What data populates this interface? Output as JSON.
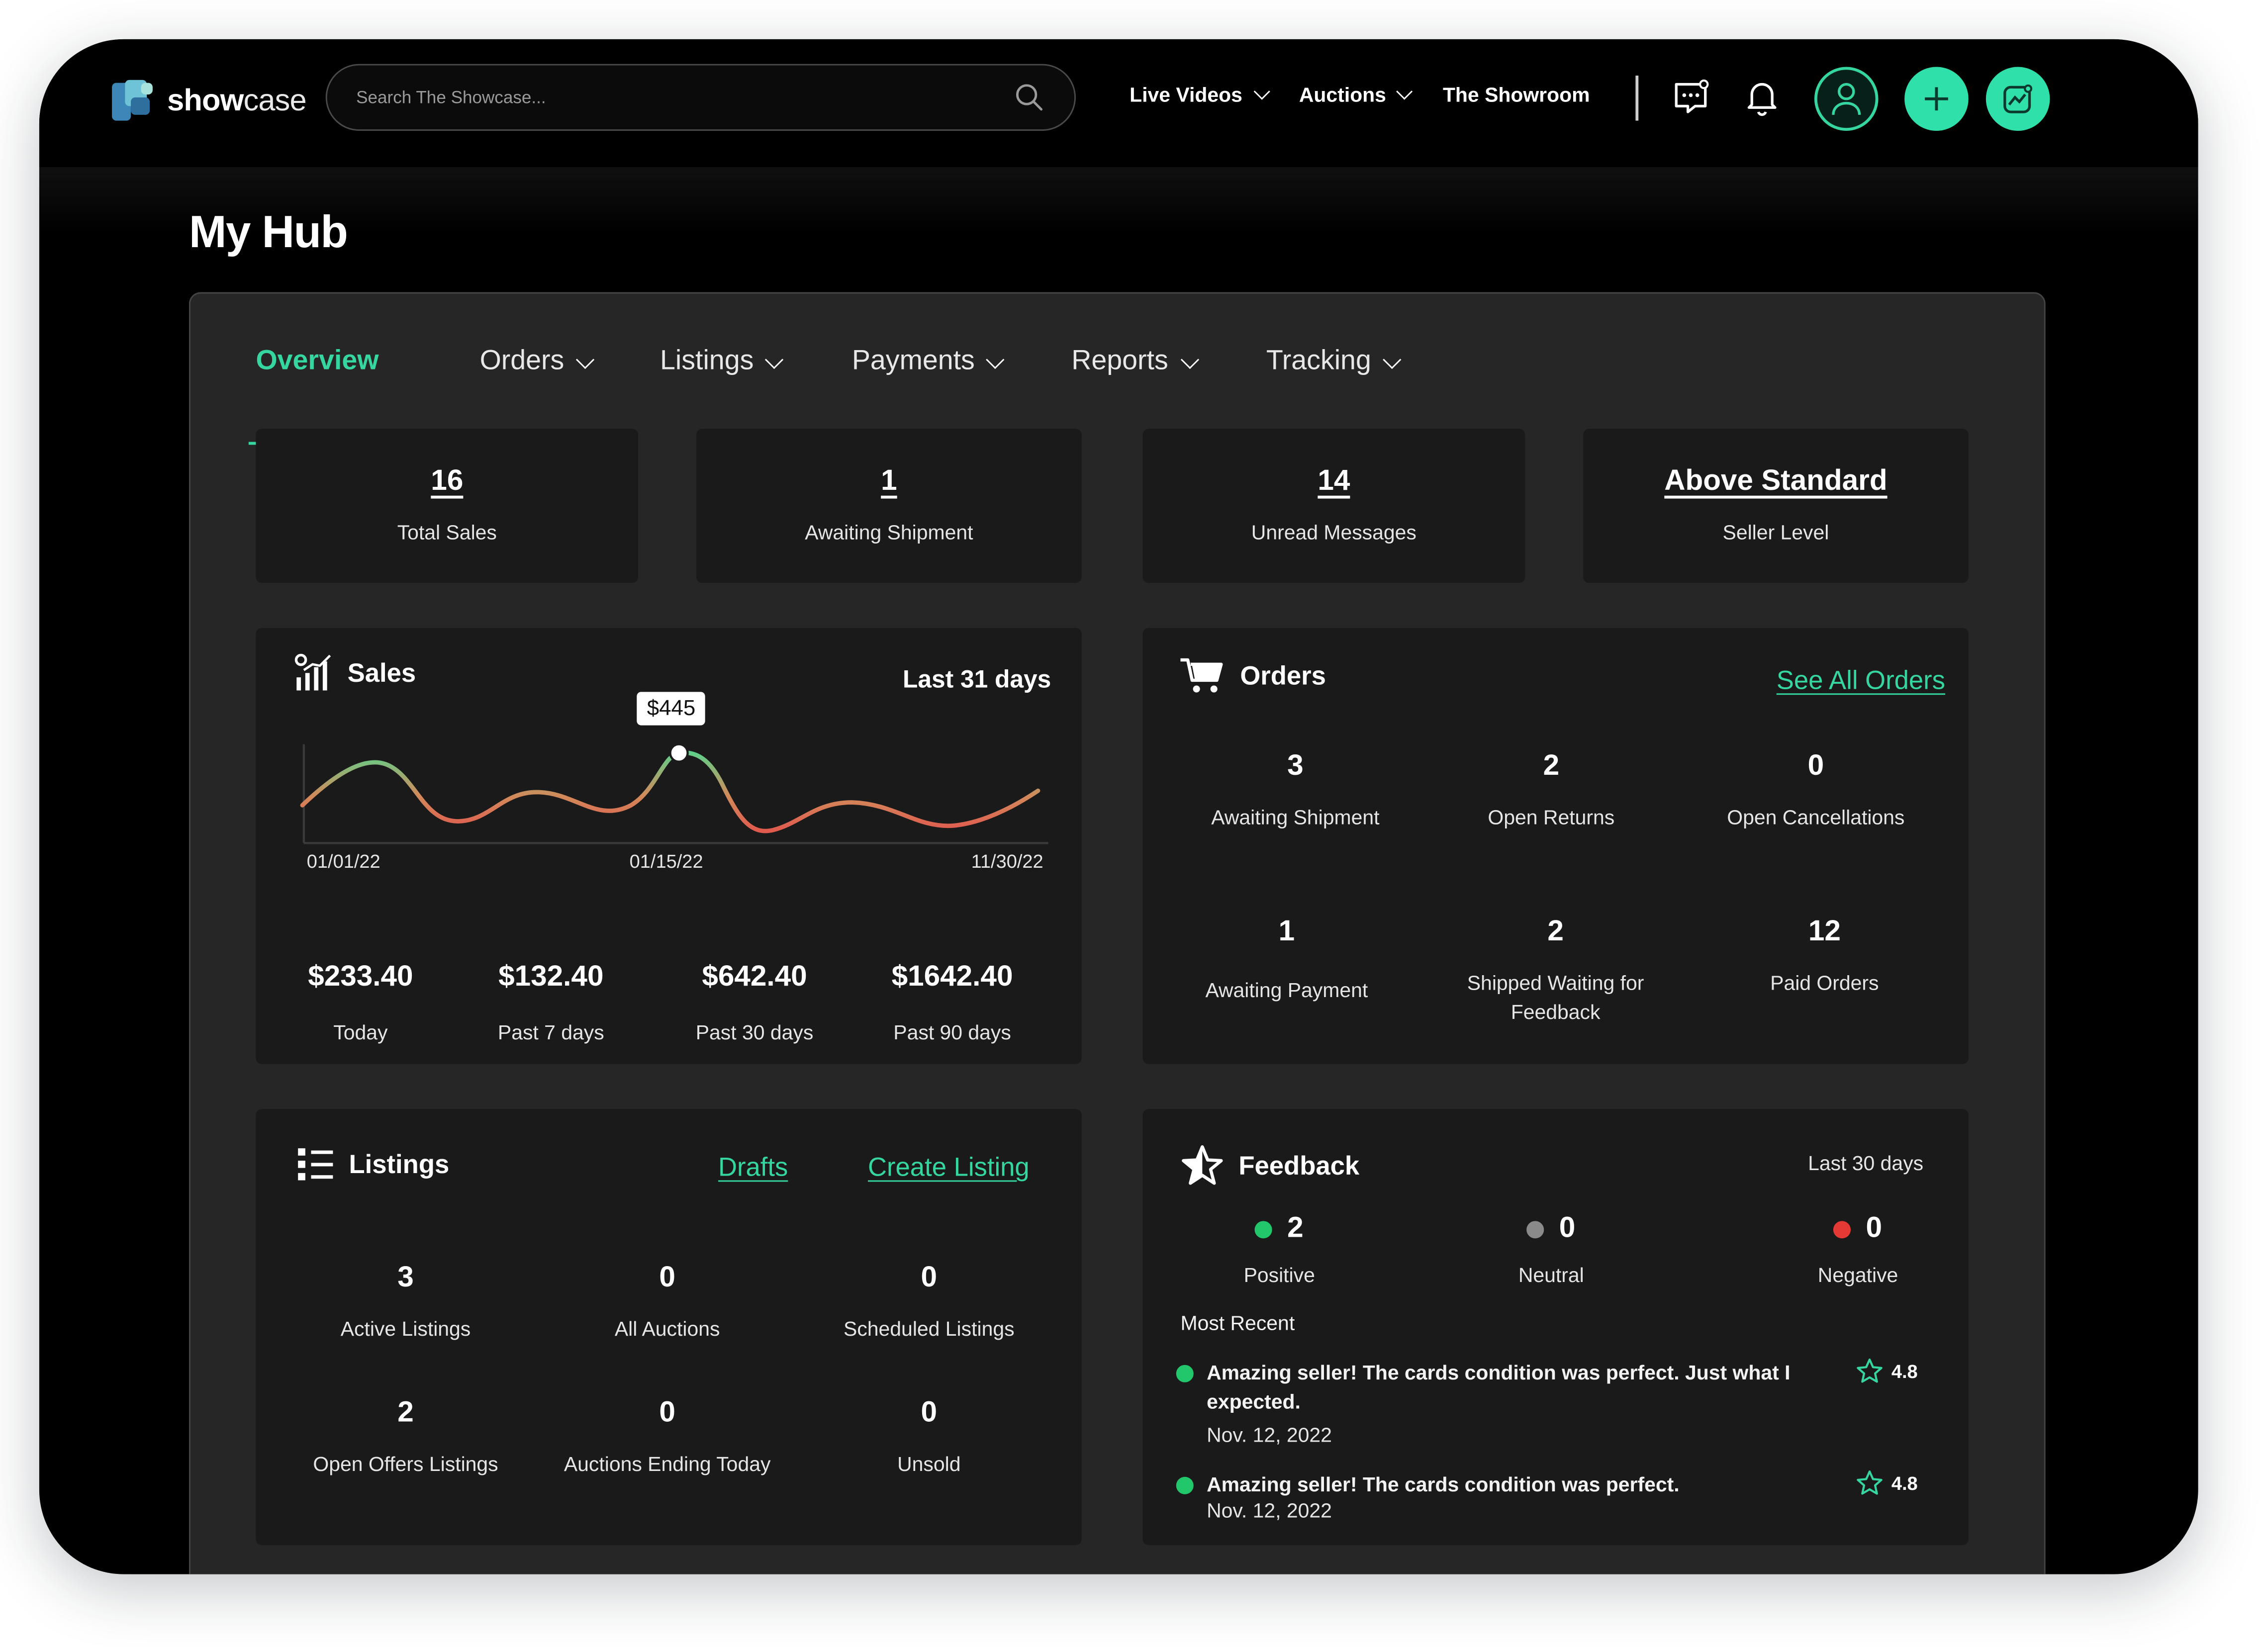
{
  "app": {
    "logo_bold": "show",
    "logo_rest": "case"
  },
  "search": {
    "placeholder": "Search The Showcase..."
  },
  "nav": {
    "live_videos": "Live Videos",
    "auctions": "Auctions",
    "showroom": "The Showroom"
  },
  "page": {
    "title": "My Hub"
  },
  "tabs": [
    "Overview",
    "Orders",
    "Listings",
    "Payments",
    "Reports",
    "Tracking"
  ],
  "stats": [
    {
      "value": "16",
      "label": "Total Sales"
    },
    {
      "value": "1",
      "label": "Awaiting Shipment"
    },
    {
      "value": "14",
      "label": "Unread Messages"
    },
    {
      "value": "Above Standard",
      "label": "Seller Level"
    }
  ],
  "sales": {
    "title": "Sales",
    "range": "Last 31 days",
    "tooltip": "$445",
    "x_labels": [
      "01/01/22",
      "01/15/22",
      "11/30/22"
    ],
    "totals": [
      {
        "value": "$233.40",
        "label": "Today"
      },
      {
        "value": "$132.40",
        "label": "Past 7 days"
      },
      {
        "value": "$642.40",
        "label": "Past 30 days"
      },
      {
        "value": "$1642.40",
        "label": "Past 90 days"
      }
    ]
  },
  "chart_data": {
    "type": "line",
    "x": [
      "01/01/22",
      "01/15/22",
      "11/30/22"
    ],
    "highlight": {
      "label": "$445",
      "value": 445
    },
    "gradient": [
      "#5fd08a",
      "#e05a4e"
    ]
  },
  "orders": {
    "title": "Orders",
    "link": "See All Orders",
    "metrics": [
      {
        "value": "3",
        "label": "Awaiting Shipment"
      },
      {
        "value": "2",
        "label": "Open Returns"
      },
      {
        "value": "0",
        "label": "Open Cancellations"
      },
      {
        "value": "1",
        "label": "Awaiting Payment"
      },
      {
        "value": "2",
        "label": "Shipped Waiting for Feedback"
      },
      {
        "value": "12",
        "label": "Paid Orders"
      }
    ]
  },
  "listings": {
    "title": "Listings",
    "drafts": "Drafts",
    "create": "Create Listing",
    "metrics": [
      {
        "value": "3",
        "label": "Active Listings"
      },
      {
        "value": "0",
        "label": "All Auctions"
      },
      {
        "value": "0",
        "label": "Scheduled Listings"
      },
      {
        "value": "2",
        "label": "Open Offers Listings"
      },
      {
        "value": "0",
        "label": "Auctions Ending Today"
      },
      {
        "value": "0",
        "label": "Unsold"
      }
    ]
  },
  "feedback": {
    "title": "Feedback",
    "range": "Last 30 days",
    "counts": [
      {
        "value": "2",
        "label": "Positive",
        "color": "#22c76b"
      },
      {
        "value": "0",
        "label": "Neutral",
        "color": "#8a8a8a"
      },
      {
        "value": "0",
        "label": "Negative",
        "color": "#e53935"
      }
    ],
    "recent_label": "Most Recent",
    "reviews": [
      {
        "text": "Amazing seller! The cards condition was perfect. Just what I expected.",
        "date": "Nov. 12, 2022",
        "rating": "4.8"
      },
      {
        "text": "Amazing seller! The cards condition was perfect.",
        "date": "Nov. 12, 2022",
        "rating": "4.8"
      }
    ]
  },
  "colors": {
    "accent": "#35d6a0",
    "card": "#1a1a1a",
    "panel": "#262626",
    "background": "#000000"
  }
}
